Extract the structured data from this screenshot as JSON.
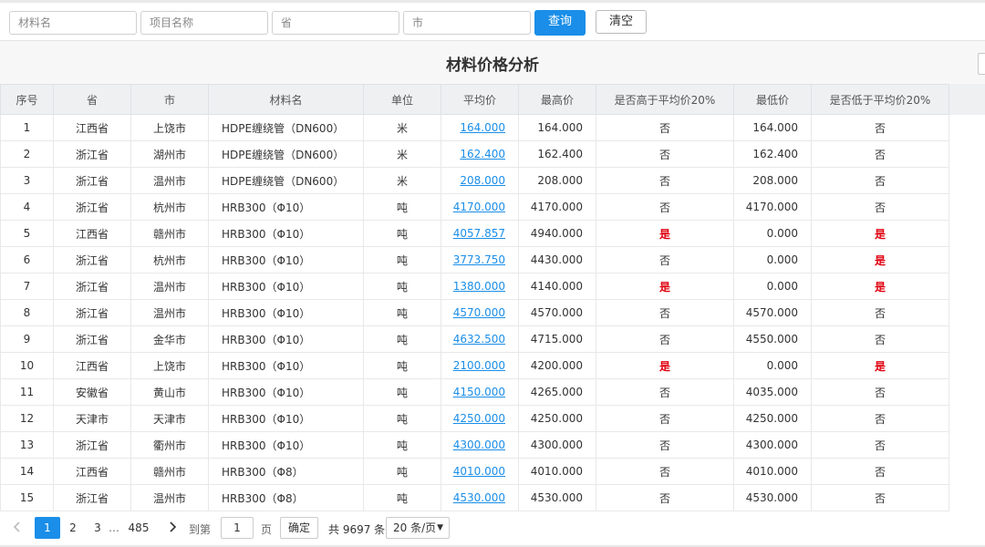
{
  "filters": {
    "material_placeholder": "材料名",
    "project_placeholder": "项目名称",
    "province_placeholder": "省",
    "city_placeholder": "市",
    "query_label": "查询",
    "clear_label": "清空"
  },
  "panel": {
    "title": "材料价格分析"
  },
  "table": {
    "columns": [
      "序号",
      "省",
      "市",
      "材料名",
      "单位",
      "平均价",
      "最高价",
      "是否高于平均价20%",
      "最低价",
      "是否低于平均价20%"
    ],
    "rows": [
      {
        "no": "1",
        "province": "江西省",
        "city": "上饶市",
        "material": "HDPE缠绕管（DN600）",
        "unit": "米",
        "avg": "164.000",
        "max": "164.000",
        "above": "否",
        "min": "164.000",
        "below": "否"
      },
      {
        "no": "2",
        "province": "浙江省",
        "city": "湖州市",
        "material": "HDPE缠绕管（DN600）",
        "unit": "米",
        "avg": "162.400",
        "max": "162.400",
        "above": "否",
        "min": "162.400",
        "below": "否"
      },
      {
        "no": "3",
        "province": "浙江省",
        "city": "温州市",
        "material": "HDPE缠绕管（DN600）",
        "unit": "米",
        "avg": "208.000",
        "max": "208.000",
        "above": "否",
        "min": "208.000",
        "below": "否"
      },
      {
        "no": "4",
        "province": "浙江省",
        "city": "杭州市",
        "material": "HRB300（Φ10）",
        "unit": "吨",
        "avg": "4170.000",
        "max": "4170.000",
        "above": "否",
        "min": "4170.000",
        "below": "否"
      },
      {
        "no": "5",
        "province": "江西省",
        "city": "赣州市",
        "material": "HRB300（Φ10）",
        "unit": "吨",
        "avg": "4057.857",
        "max": "4940.000",
        "above": "是",
        "min": "0.000",
        "below": "是"
      },
      {
        "no": "6",
        "province": "浙江省",
        "city": "杭州市",
        "material": "HRB300（Φ10）",
        "unit": "吨",
        "avg": "3773.750",
        "max": "4430.000",
        "above": "否",
        "min": "0.000",
        "below": "是"
      },
      {
        "no": "7",
        "province": "浙江省",
        "city": "温州市",
        "material": "HRB300（Φ10）",
        "unit": "吨",
        "avg": "1380.000",
        "max": "4140.000",
        "above": "是",
        "min": "0.000",
        "below": "是"
      },
      {
        "no": "8",
        "province": "浙江省",
        "city": "温州市",
        "material": "HRB300（Φ10）",
        "unit": "吨",
        "avg": "4570.000",
        "max": "4570.000",
        "above": "否",
        "min": "4570.000",
        "below": "否"
      },
      {
        "no": "9",
        "province": "浙江省",
        "city": "金华市",
        "material": "HRB300（Φ10）",
        "unit": "吨",
        "avg": "4632.500",
        "max": "4715.000",
        "above": "否",
        "min": "4550.000",
        "below": "否"
      },
      {
        "no": "10",
        "province": "江西省",
        "city": "上饶市",
        "material": "HRB300（Φ10）",
        "unit": "吨",
        "avg": "2100.000",
        "max": "4200.000",
        "above": "是",
        "min": "0.000",
        "below": "是"
      },
      {
        "no": "11",
        "province": "安徽省",
        "city": "黄山市",
        "material": "HRB300（Φ10）",
        "unit": "吨",
        "avg": "4150.000",
        "max": "4265.000",
        "above": "否",
        "min": "4035.000",
        "below": "否"
      },
      {
        "no": "12",
        "province": "天津市",
        "city": "天津市",
        "material": "HRB300（Φ10）",
        "unit": "吨",
        "avg": "4250.000",
        "max": "4250.000",
        "above": "否",
        "min": "4250.000",
        "below": "否"
      },
      {
        "no": "13",
        "province": "浙江省",
        "city": "衢州市",
        "material": "HRB300（Φ10）",
        "unit": "吨",
        "avg": "4300.000",
        "max": "4300.000",
        "above": "否",
        "min": "4300.000",
        "below": "否"
      },
      {
        "no": "14",
        "province": "江西省",
        "city": "赣州市",
        "material": "HRB300（Φ8）",
        "unit": "吨",
        "avg": "4010.000",
        "max": "4010.000",
        "above": "否",
        "min": "4010.000",
        "below": "否"
      },
      {
        "no": "15",
        "province": "浙江省",
        "city": "温州市",
        "material": "HRB300（Φ8）",
        "unit": "吨",
        "avg": "4530.000",
        "max": "4530.000",
        "above": "否",
        "min": "4530.000",
        "below": "否"
      }
    ]
  },
  "pagination": {
    "prev_icon": "chevron-left-icon",
    "next_icon": "chevron-right-icon",
    "pages": [
      "1",
      "2",
      "3"
    ],
    "ellipsis": "…",
    "last_page": "485",
    "goto_label": "到第",
    "goto_value": "1",
    "page_unit": "页",
    "confirm_label": "确定",
    "total_text": "共 9697 条",
    "page_size": "20 条/页"
  },
  "colors": {
    "accent": "#1a8ee8",
    "flag_red": "#e0000f"
  }
}
